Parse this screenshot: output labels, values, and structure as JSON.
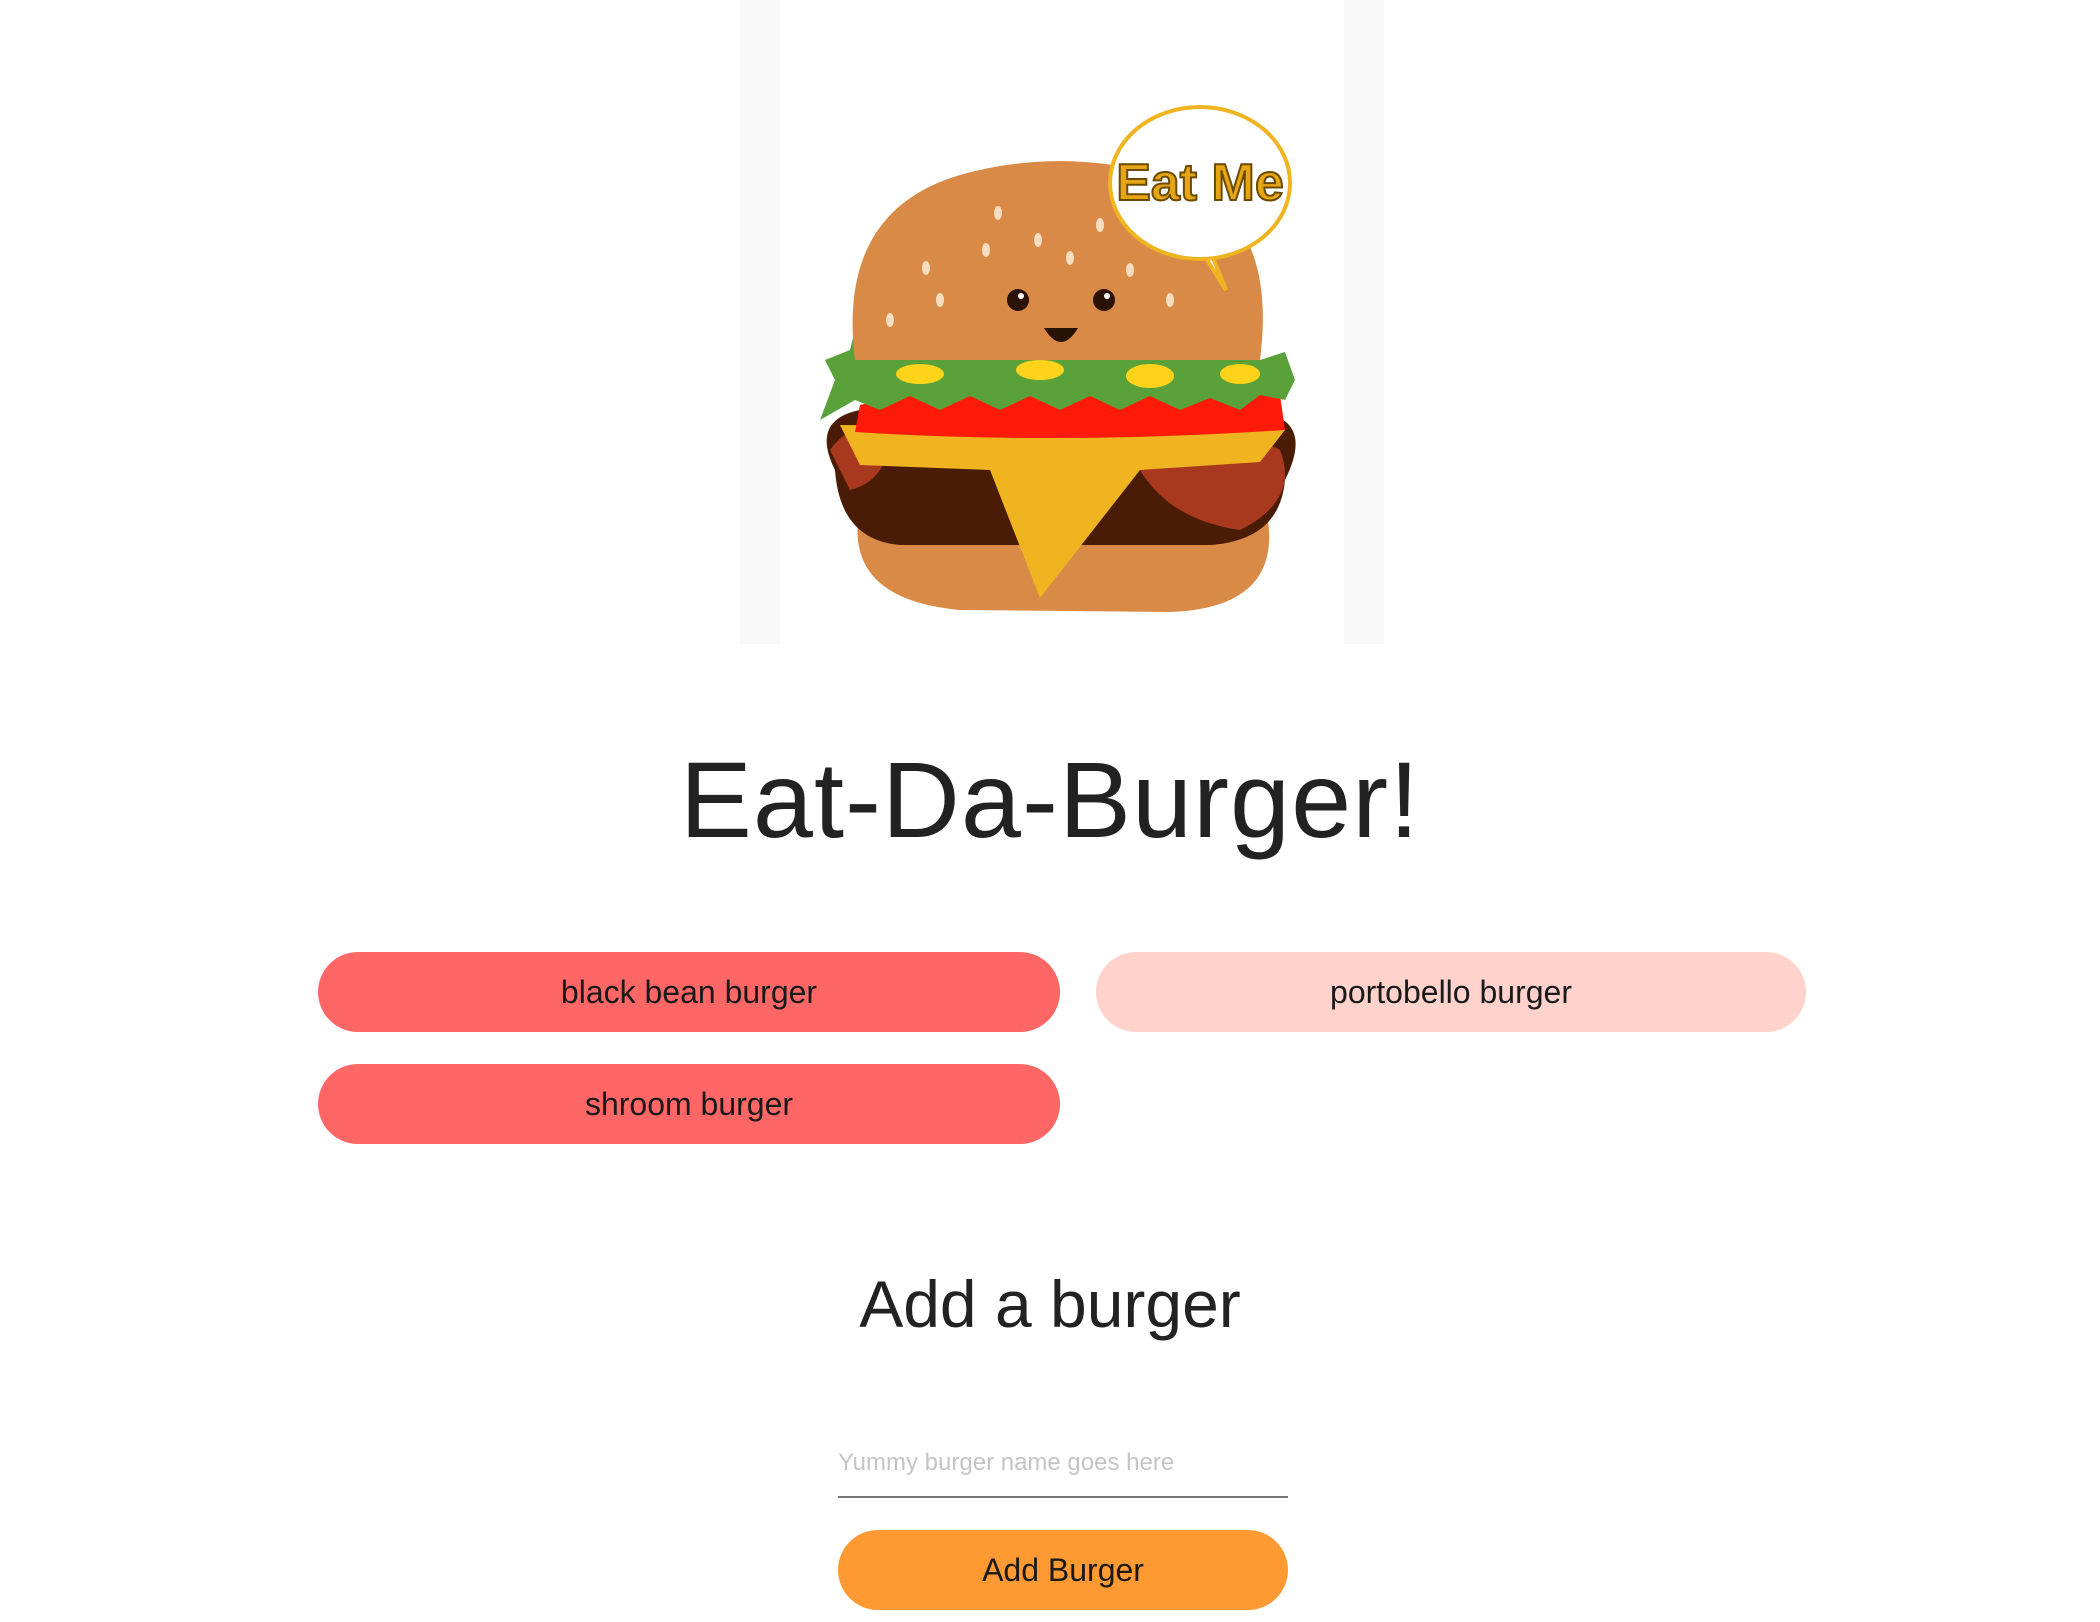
{
  "hero": {
    "speech_bubble_text": "Eat Me"
  },
  "header": {
    "title": "Eat-Da-Burger!"
  },
  "burgers": [
    {
      "label": "black bean burger",
      "state": "uneaten",
      "color": "#ff6666"
    },
    {
      "label": "portobello burger",
      "state": "devoured",
      "color": "#ffd2cb"
    },
    {
      "label": "shroom burger",
      "state": "uneaten",
      "color": "#ff6666"
    }
  ],
  "add_form": {
    "title": "Add a burger",
    "input_placeholder": "Yummy burger name goes here",
    "input_value": "",
    "submit_label": "Add Burger",
    "submit_color": "#ff9a33"
  },
  "colors": {
    "uneaten_button": "#ff6666",
    "devoured_button": "#ffd2cb",
    "add_button": "#ff9a33",
    "text": "#222222"
  }
}
